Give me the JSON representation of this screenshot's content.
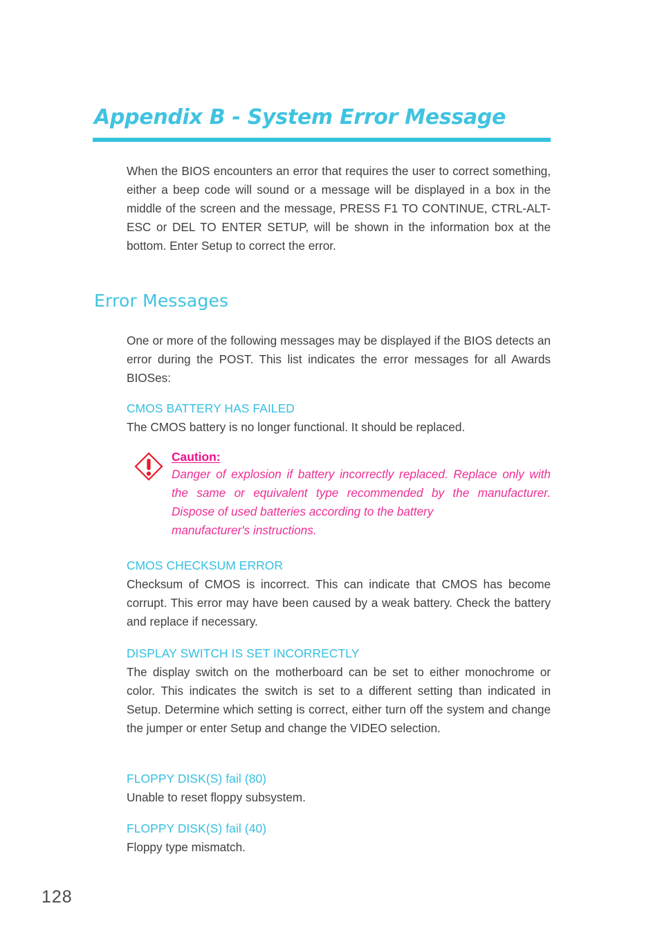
{
  "page": {
    "number": "128",
    "accent_cyan": "#35bfe0",
    "accent_pink": "#ed0f8c",
    "icon_red": "#e8192c",
    "body_color": "#3f3f41"
  },
  "header": {
    "title": "Appendix B - System Error Message"
  },
  "intro": {
    "paragraph": "When the BIOS encounters an error that requires the user to correct something, either a beep code will sound or a message will be displayed in a box in the middle of the screen and the message, PRESS F1 TO CONTINUE, CTRL-ALT-ESC or DEL TO ENTER SETUP, will be shown in the information box at the bottom. Enter Setup to correct the error."
  },
  "section": {
    "heading": "Error Messages",
    "intro": "One or more of the following messages may be displayed if the BIOS detects an error during the POST. This list indicates the error messages for all Awards BIOSes:"
  },
  "errors": [
    {
      "heading": "CMOS BATTERY HAS FAILED",
      "body": "The CMOS battery is no longer functional. It should be replaced."
    },
    {
      "heading": "CMOS CHECKSUM ERROR",
      "body": "Checksum of CMOS is incorrect. This can indicate that CMOS has become corrupt. This error may have been caused by a weak battery. Check the battery and replace if necessary."
    },
    {
      "heading": "DISPLAY SWITCH IS SET INCORRECTLY",
      "body": "The display switch on the motherboard can be set to either monochrome or color. This indicates the switch is set to a different setting than indicated in Setup. Determine which setting is correct, either turn off the system and change the jumper or enter Setup and change the VIDEO selection."
    },
    {
      "heading": "FLOPPY DISK(S) fail (80)",
      "body": "Unable to reset floppy subsystem."
    },
    {
      "heading": "FLOPPY DISK(S) fail (40)",
      "body": "Floppy type mismatch."
    }
  ],
  "caution": {
    "icon": "warning-diamond-icon",
    "label": "Caution:",
    "body": "Danger of explosion if battery incorrectly replaced. Replace only with the same or equivalent type recommended by the manufacturer. Dispose of used batteries according to the battery",
    "body_tail": "manufacturer's instructions."
  }
}
